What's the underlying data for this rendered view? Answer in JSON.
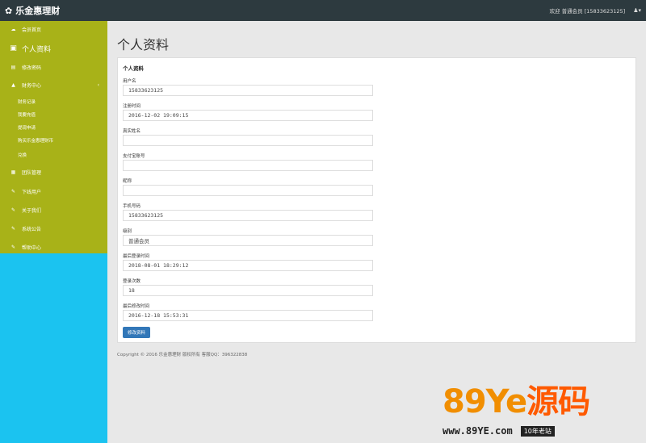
{
  "header": {
    "brand": "乐金惠理财",
    "welcome": "欢迎 普通会员 [15833623125]"
  },
  "sidebar": {
    "items": [
      {
        "label": "会员首页",
        "icon": "cloud-icon"
      },
      {
        "label": "个人资料",
        "icon": "monitor-icon"
      },
      {
        "label": "修改密码",
        "icon": "chart-icon"
      },
      {
        "label": "财务中心",
        "icon": "sitemap-icon"
      },
      {
        "label": "团队管理",
        "icon": "grid-icon"
      },
      {
        "label": "下线用户",
        "icon": "edit-icon"
      },
      {
        "label": "关于我们",
        "icon": "edit-icon"
      },
      {
        "label": "系统公告",
        "icon": "edit-icon"
      },
      {
        "label": "帮助中心",
        "icon": "edit-icon"
      }
    ],
    "finance_sub": [
      "财务记录",
      "我要充值",
      "提现申请",
      "购买乐金惠理财币",
      "兑换"
    ]
  },
  "page": {
    "title": "个人资料",
    "card_title": "个人资料",
    "fields": [
      {
        "label": "用户名",
        "value": "15833623125"
      },
      {
        "label": "注册时间",
        "value": "2016-12-02 19:09:15"
      },
      {
        "label": "真实姓名",
        "value": ""
      },
      {
        "label": "支付宝账号",
        "value": ""
      },
      {
        "label": "昵称",
        "value": ""
      },
      {
        "label": "手机号码",
        "value": "15833623125"
      },
      {
        "label": "级别",
        "value": "普通会员"
      },
      {
        "label": "最后登录时间",
        "value": "2018-08-01 18:29:12"
      },
      {
        "label": "登录次数",
        "value": "18"
      },
      {
        "label": "最后修改时间",
        "value": "2016-12-18 15:53:31"
      }
    ],
    "submit_label": "修改资料",
    "footer": "Copyright © 2016 乐金惠理财 版权所有 客服QQ：396322838"
  },
  "watermark": {
    "big_1": "89",
    "big_2": "Ye",
    "big_3": "源码",
    "url": "www.89YE.com",
    "tag": "10年老站"
  },
  "colors": {
    "navbar": "#2d3a3f",
    "sidebar_top": "#a8b218",
    "sidebar_bottom": "#1bc3f0",
    "button": "#3277b8"
  }
}
